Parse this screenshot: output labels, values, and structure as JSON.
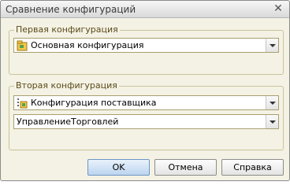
{
  "window": {
    "title": "Сравнение конфигураций",
    "close_icon": "close-icon"
  },
  "first_group": {
    "legend": "Первая конфигурация",
    "combo": {
      "value": "Основная конфигурация",
      "icon": "configuration-icon"
    }
  },
  "second_group": {
    "legend": "Вторая конфигурация",
    "combo_type": {
      "value": "Конфигурация поставщика",
      "icon": "vendor-configuration-icon"
    },
    "combo_name": {
      "value": "УправлениеТорговлей"
    }
  },
  "buttons": {
    "ok": "OK",
    "cancel": "Отмена",
    "help": "Справка"
  }
}
